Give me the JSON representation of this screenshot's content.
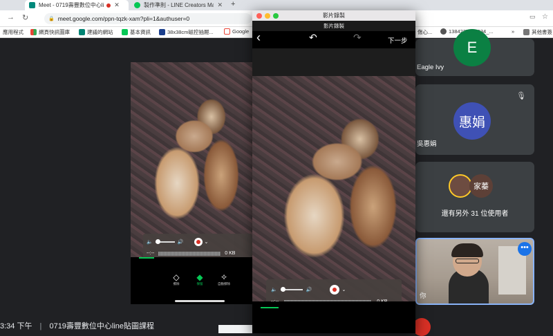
{
  "browser": {
    "tabs": [
      {
        "title": "Meet - 0719壽豐數位中心li",
        "active": true
      },
      {
        "title": "製作準則 - LINE Creators Marke",
        "active": false
      }
    ],
    "new_tab": "+",
    "url": "meet.google.com/ppn-tqzk-xam?pli=1&authuser=0",
    "bookmarks": [
      {
        "label": "應用程式",
        "color": "#4285f4"
      },
      {
        "label": "網頁快訊圖庫",
        "color": "#fbbc05"
      },
      {
        "label": "建議的網站",
        "color": "#008373"
      },
      {
        "label": "基本資訊",
        "color": "#06c755"
      },
      {
        "label": "38x38cm磁控抽屜...",
        "color": "#1a3e8c"
      },
      {
        "label": "Google",
        "color": "#ea4335"
      },
      {
        "label": "傷心...",
        "color": "#888888"
      },
      {
        "label": "1384227589934_...",
        "color": "#555555"
      },
      {
        "label": "»",
        "color": ""
      },
      {
        "label": "其他書簽",
        "color": "#555555"
      }
    ]
  },
  "recorder": {
    "window_title": "影片錄製",
    "subtitle": "影片錄製",
    "toolbar": {
      "back": "‹",
      "undo": "↶",
      "redo": "↷",
      "next": "下一步"
    },
    "time": "--:--",
    "size": "0 KB"
  },
  "left_share": {
    "time": "--:--",
    "size": "0 KB",
    "tools": [
      "擦除",
      "保留",
      "自動擦除"
    ]
  },
  "participants": {
    "eagle": {
      "initial": "E",
      "name": "Eagle Ivy",
      "color": "#0b8043"
    },
    "huijuan": {
      "initial": "惠娟",
      "name": "吳惠娟",
      "color": "#3f51b5"
    },
    "others": {
      "text": "還有另外 31 位使用者",
      "avatar_label": "家蓁"
    },
    "self": {
      "name": "你"
    }
  },
  "bottom": {
    "time": "3:34 下午",
    "separator": "|",
    "meeting": "0719壽豐數位中心line貼圖課程"
  }
}
